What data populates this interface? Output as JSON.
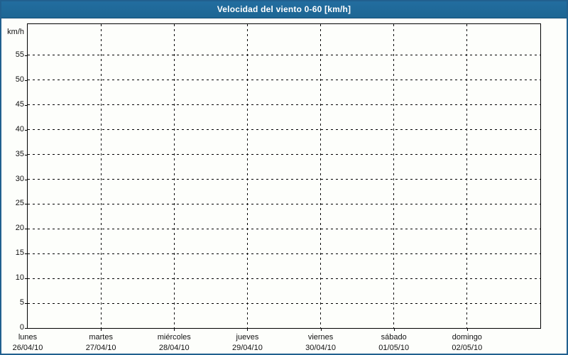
{
  "title_bar": {
    "title": "Velocidad del viento 0-60 [km/h]",
    "background_color": "#1e6899",
    "text_color": "#ffffff"
  },
  "chart_data": {
    "type": "line",
    "title": "Velocidad del viento 0-60 [km/h]",
    "ylabel_unit": "km/h",
    "ylim": [
      0,
      61.3
    ],
    "y_ticks": [
      0,
      5,
      10,
      15,
      20,
      25,
      30,
      35,
      40,
      45,
      50,
      55
    ],
    "categories": [
      {
        "day": "lunes",
        "date": "26/04/10"
      },
      {
        "day": "martes",
        "date": "27/04/10"
      },
      {
        "day": "miércoles",
        "date": "28/04/10"
      },
      {
        "day": "jueves",
        "date": "29/04/10"
      },
      {
        "day": "viernes",
        "date": "30/04/10"
      },
      {
        "day": "sábado",
        "date": "01/05/10"
      },
      {
        "day": "domingo",
        "date": "02/05/10"
      }
    ],
    "series": [],
    "grid": {
      "style": "dashed",
      "horizontal": true,
      "vertical": true,
      "color": "#000000"
    },
    "legend_position": "none",
    "plot_background": "#fdfefb",
    "axis_color": "#000000",
    "frame_border_color": "#21608f"
  }
}
